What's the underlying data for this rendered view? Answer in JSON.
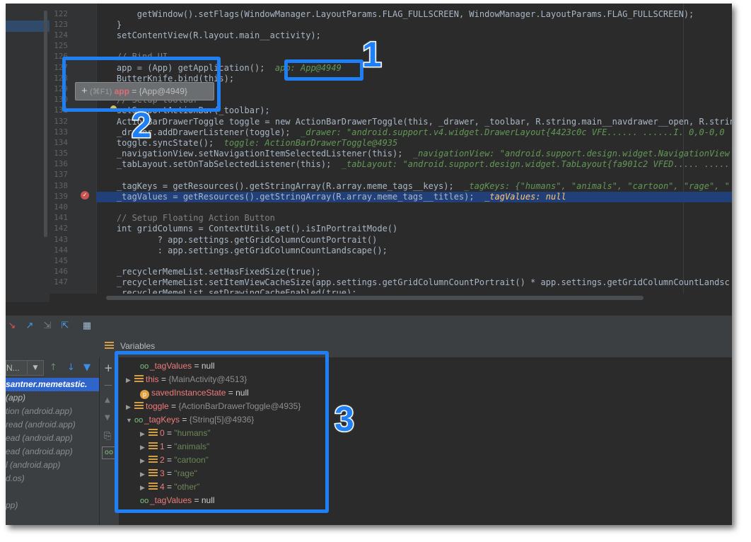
{
  "editor": {
    "line_numbers": [
      "122",
      "123",
      "124",
      "125",
      "126",
      "127",
      "128",
      "129",
      "130",
      "131",
      "132",
      "133",
      "134",
      "135",
      "136",
      "137",
      "138",
      "139",
      "140",
      "141",
      "142",
      "143",
      "144",
      "145",
      "146",
      "147"
    ],
    "lines": [
      {
        "text": "        getWindow().setFlags(WindowManager.LayoutParams.FLAG_FULLSCREEN, WindowManager.LayoutParams.FLAG_FULLSCREEN);"
      },
      {
        "text": "    }"
      },
      {
        "text": "    setContentView(R.layout.main__activity);"
      },
      {
        "text": ""
      },
      {
        "text": "    // Bind UI"
      },
      {
        "text": "    app = (App) getApplication();",
        "hint": "  app: App@4949"
      },
      {
        "text": "    ButterKnife.bind(this);"
      },
      {
        "text": ""
      },
      {
        "text": "    // Setup toolbar"
      },
      {
        "text": "    setSupportActionBar(_toolbar);"
      },
      {
        "text": "    ActionBarDrawerToggle toggle = new ActionBarDrawerToggle(this, _drawer, _toolbar, R.string.main__navdrawer__open, R.string"
      },
      {
        "text": "    _drawer.addDrawerListener(toggle);",
        "hint": "  _drawer: \"android.support.v4.widget.DrawerLayout{4423c0c VFE...... ......I. 0,0-0,0"
      },
      {
        "text": "    toggle.syncState();",
        "hint": "  toggle: ActionBarDrawerToggle@4935"
      },
      {
        "text": "    _navigationView.setNavigationItemSelectedListener(this);",
        "hint": "  _navigationView: \"android.support.design.widget.NavigationView"
      },
      {
        "text": "    _tabLayout.setOnTabSelectedListener(this);",
        "hint": "  _tabLayout: \"android.support.design.widget.TabLayout{fa901c2 VFED..... ....."
      },
      {
        "text": ""
      },
      {
        "text": "    _tagKeys = getResources().getStringArray(R.array.meme_tags__keys);",
        "hint": "  _tagKeys: {\"humans\", \"animals\", \"cartoon\", \"rage\", \""
      },
      {
        "text": "    _tagValues = getResources().getStringArray(R.array.meme_tags__titles);",
        "hint": "  _tagValues: null",
        "highlight": true
      },
      {
        "text": ""
      },
      {
        "text": "    // Setup Floating Action Button"
      },
      {
        "text": "    int gridColumns = ContextUtils.get().isInPortraitMode()"
      },
      {
        "text": "            ? app.settings.getGridColumnCountPortrait()"
      },
      {
        "text": "            : app.settings.getGridColumnCountLandscape();"
      },
      {
        "text": ""
      },
      {
        "text": "    _recyclerMemeList.setHasFixedSize(true);"
      },
      {
        "text": "    _recyclerMemeList.setItemViewCacheSize(app.settings.getGridColumnCountPortrait() * app.settings.getGridColumnCountLandsc"
      },
      {
        "text": "    _recyclerMemeList.setDrawingCacheEnabled(true);"
      }
    ]
  },
  "tooltip": {
    "shortcut": "(⌘F1)",
    "var": "app",
    "eq": " = ",
    "value": "{App@4949}"
  },
  "callouts": [
    "1",
    "2",
    "3"
  ],
  "frames": {
    "thread_label": "N...",
    "rows": [
      {
        "text": "santner.memetastic."
      },
      {
        "text": "(app)"
      },
      {
        "text": "tion (android.app)"
      },
      {
        "text": "read (android.app)"
      },
      {
        "text": "ead (android.app)"
      },
      {
        "text": "ead (android.app)"
      },
      {
        "text": "l (android.app)"
      },
      {
        "text": "d.os)"
      },
      {
        "text": ""
      },
      {
        "text": "pp)"
      },
      {
        "text": ""
      }
    ]
  },
  "variables": {
    "title": "Variables",
    "rows": [
      {
        "name": "_tagValues",
        "eq": " = ",
        "value": "null"
      },
      {
        "name": "this",
        "eq": " = ",
        "value": "{MainActivity@4513}"
      },
      {
        "name": "savedInstanceState",
        "eq": " = ",
        "value": "null"
      },
      {
        "name": "toggle",
        "eq": " = ",
        "value": "{ActionBarDrawerToggle@4935}"
      },
      {
        "name": "_tagKeys",
        "eq": " = ",
        "value": "{String[5]@4936}"
      },
      {
        "name": "0",
        "eq": " = ",
        "value": "\"humans\""
      },
      {
        "name": "1",
        "eq": " = ",
        "value": "\"animals\""
      },
      {
        "name": "2",
        "eq": " = ",
        "value": "\"cartoon\""
      },
      {
        "name": "3",
        "eq": " = ",
        "value": "\"rage\""
      },
      {
        "name": "4",
        "eq": " = ",
        "value": "\"other\""
      },
      {
        "name": "_tagValues",
        "eq": " = ",
        "value": "null"
      }
    ]
  },
  "colors": {
    "callout": "#1f7ff5",
    "selection": "#21407a",
    "frame_selected": "#2f65ca"
  }
}
